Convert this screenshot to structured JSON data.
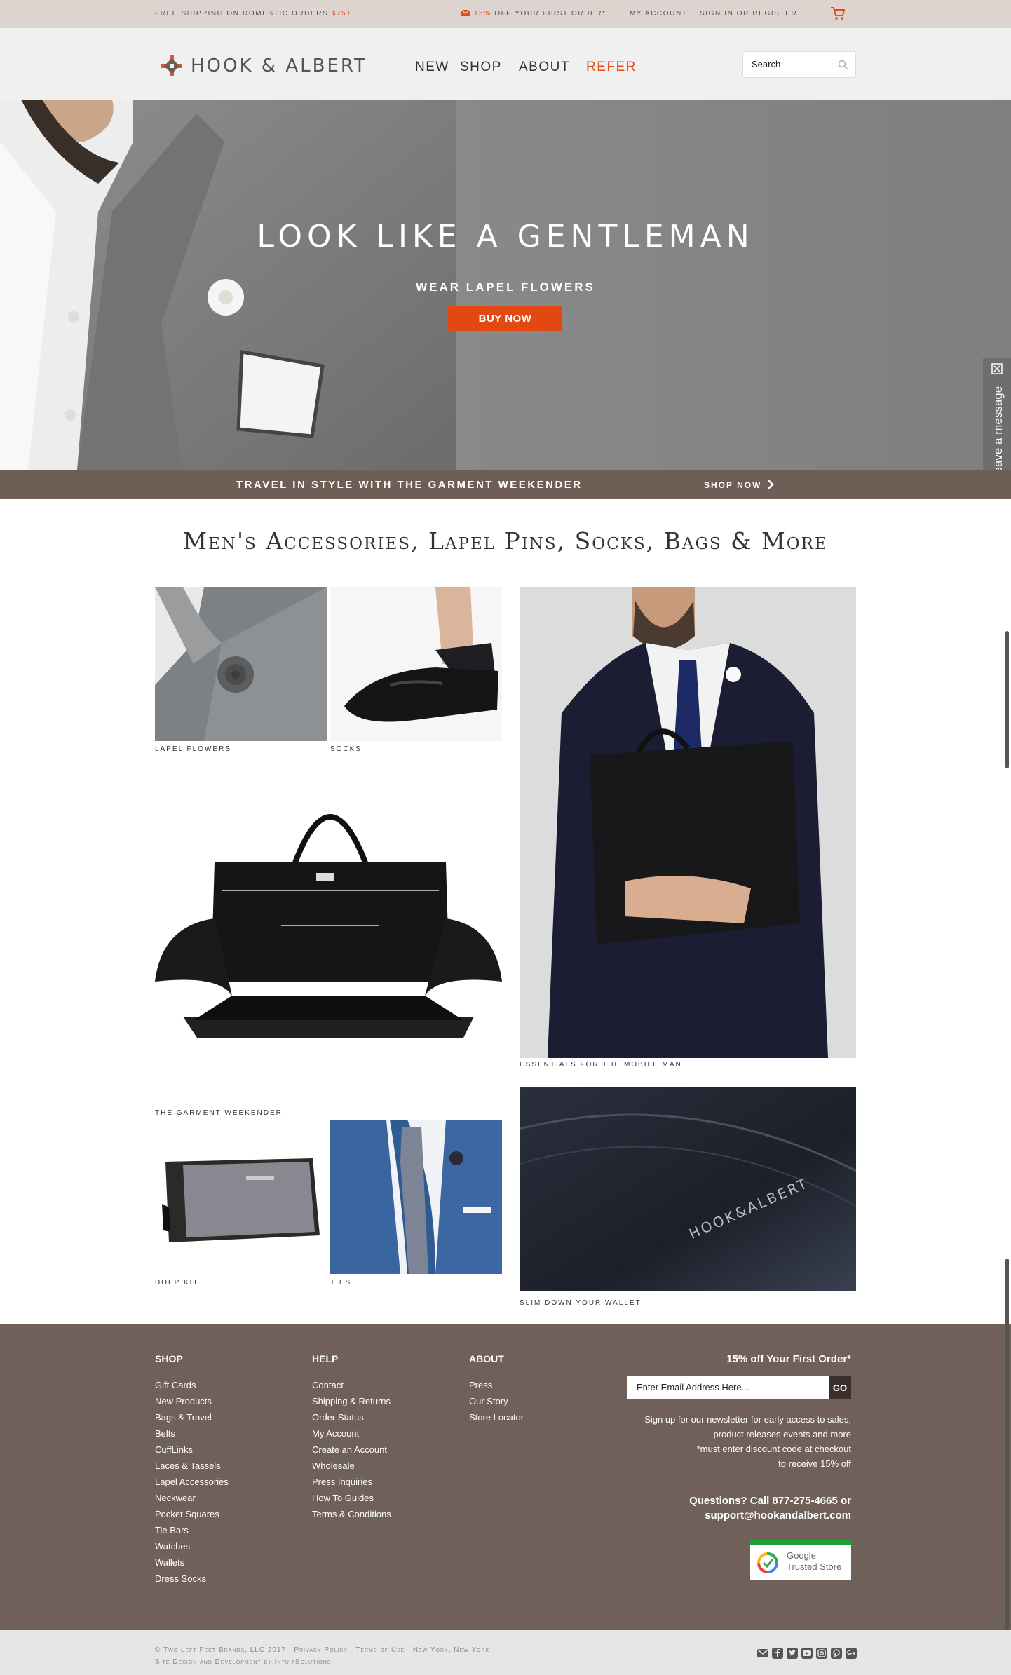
{
  "promo": {
    "shipping_text": "Free shipping on domestic orders",
    "shipping_amount": "$75+",
    "offer_percent": "15%",
    "offer_text": "off your first order*",
    "my_account": "My Account",
    "sign_in": "Sign in or Register"
  },
  "header": {
    "logo_text": "HOOK & ALBERT",
    "nav": [
      "NEW",
      "SHOP",
      "ABOUT",
      "REFER"
    ],
    "search_placeholder": "Search"
  },
  "hero": {
    "title": "Look Like A Gentleman",
    "subtitle": "Wear Lapel Flowers",
    "button": "BUY NOW"
  },
  "chat": {
    "label": "Leave a message"
  },
  "band": {
    "text": "Travel in style with the Garment Weekender",
    "link": "Shop Now"
  },
  "section": {
    "title": "Men's Accessories, Lapel Pins, Socks, Bags & More"
  },
  "tiles": {
    "lapel_flowers": "Lapel Flowers",
    "socks": "Socks",
    "essentials": "Essentials for the Mobile Man",
    "garment_weekender": "The Garment Weekender",
    "dopp_kit": "Dopp Kit",
    "ties": "Ties",
    "wallet": "Slim Down Your Wallet",
    "wallet_brand": "HOOK&ALBERT"
  },
  "footer": {
    "shop_heading": "Shop",
    "shop_links": [
      "Gift Cards",
      "New Products",
      "Bags & Travel",
      "Belts",
      "CuffLinks",
      "Laces & Tassels",
      "Lapel Accessories",
      "Neckwear",
      "Pocket Squares",
      "Tie Bars",
      "Watches",
      "Wallets",
      "Dress Socks"
    ],
    "help_heading": "Help",
    "help_links": [
      "Contact",
      "Shipping & Returns",
      "Order Status",
      "My Account",
      "Create an Account",
      "Wholesale",
      "Press Inquiries",
      "How To Guides",
      "Terms & Conditions"
    ],
    "about_heading": "About",
    "about_links": [
      "Press",
      "Our Story",
      "Store Locator"
    ],
    "offer_title": "15% off Your First Order*",
    "email_placeholder": "Enter Email Address Here...",
    "go_button": "GO",
    "signup_lines": [
      "Sign up for our newsletter for early access to sales,",
      "product releases events and more",
      "*must enter discount code at checkout",
      "to receive 15% off"
    ],
    "questions_line1": "Questions? Call 877-275-4665 or",
    "questions_line2": "support@hookandalbert.com",
    "badge_line1": "Google",
    "badge_line2": "Trusted Store"
  },
  "bottom": {
    "copyright": "© Two Left Feet Brands, LLC 2017",
    "privacy": "Privacy Policy",
    "terms": "Terms of Use",
    "location": "New York, New York",
    "credit": "Site Design and Development by IntuitSolutions",
    "social_icons": [
      "email-icon",
      "facebook-icon",
      "twitter-icon",
      "youtube-icon",
      "instagram-icon",
      "pinterest-icon",
      "google-plus-icon"
    ]
  },
  "colors": {
    "accent": "#e04e1a",
    "button": "#e2480f",
    "band": "#6f5e55",
    "footer": "#6f6059",
    "promo_bg": "#ddd3cf"
  }
}
